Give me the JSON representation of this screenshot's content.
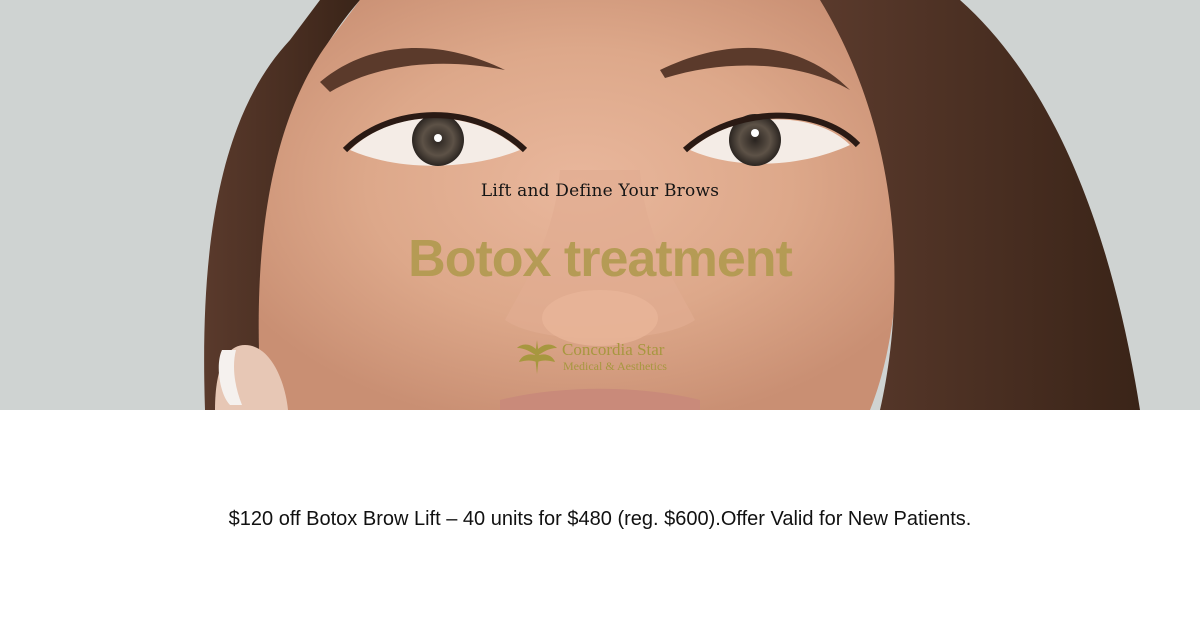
{
  "hero": {
    "image_name": "woman-face-photo",
    "tagline": "Lift and Define Your Brows",
    "headline": "Botox treatment",
    "logo": {
      "name": "Concordia Star",
      "subtitle": "Medical & Aesthetics",
      "icon": "leaf-emblem-icon"
    }
  },
  "offer": {
    "text": "$120 off Botox Brow Lift – 40 units for $480 (reg. $600).Offer Valid for New Patients."
  },
  "colors": {
    "headline": "#b39b52",
    "logo": "#a7973f",
    "tagline": "#151515",
    "offer": "#111111",
    "background": "#ffffff"
  }
}
